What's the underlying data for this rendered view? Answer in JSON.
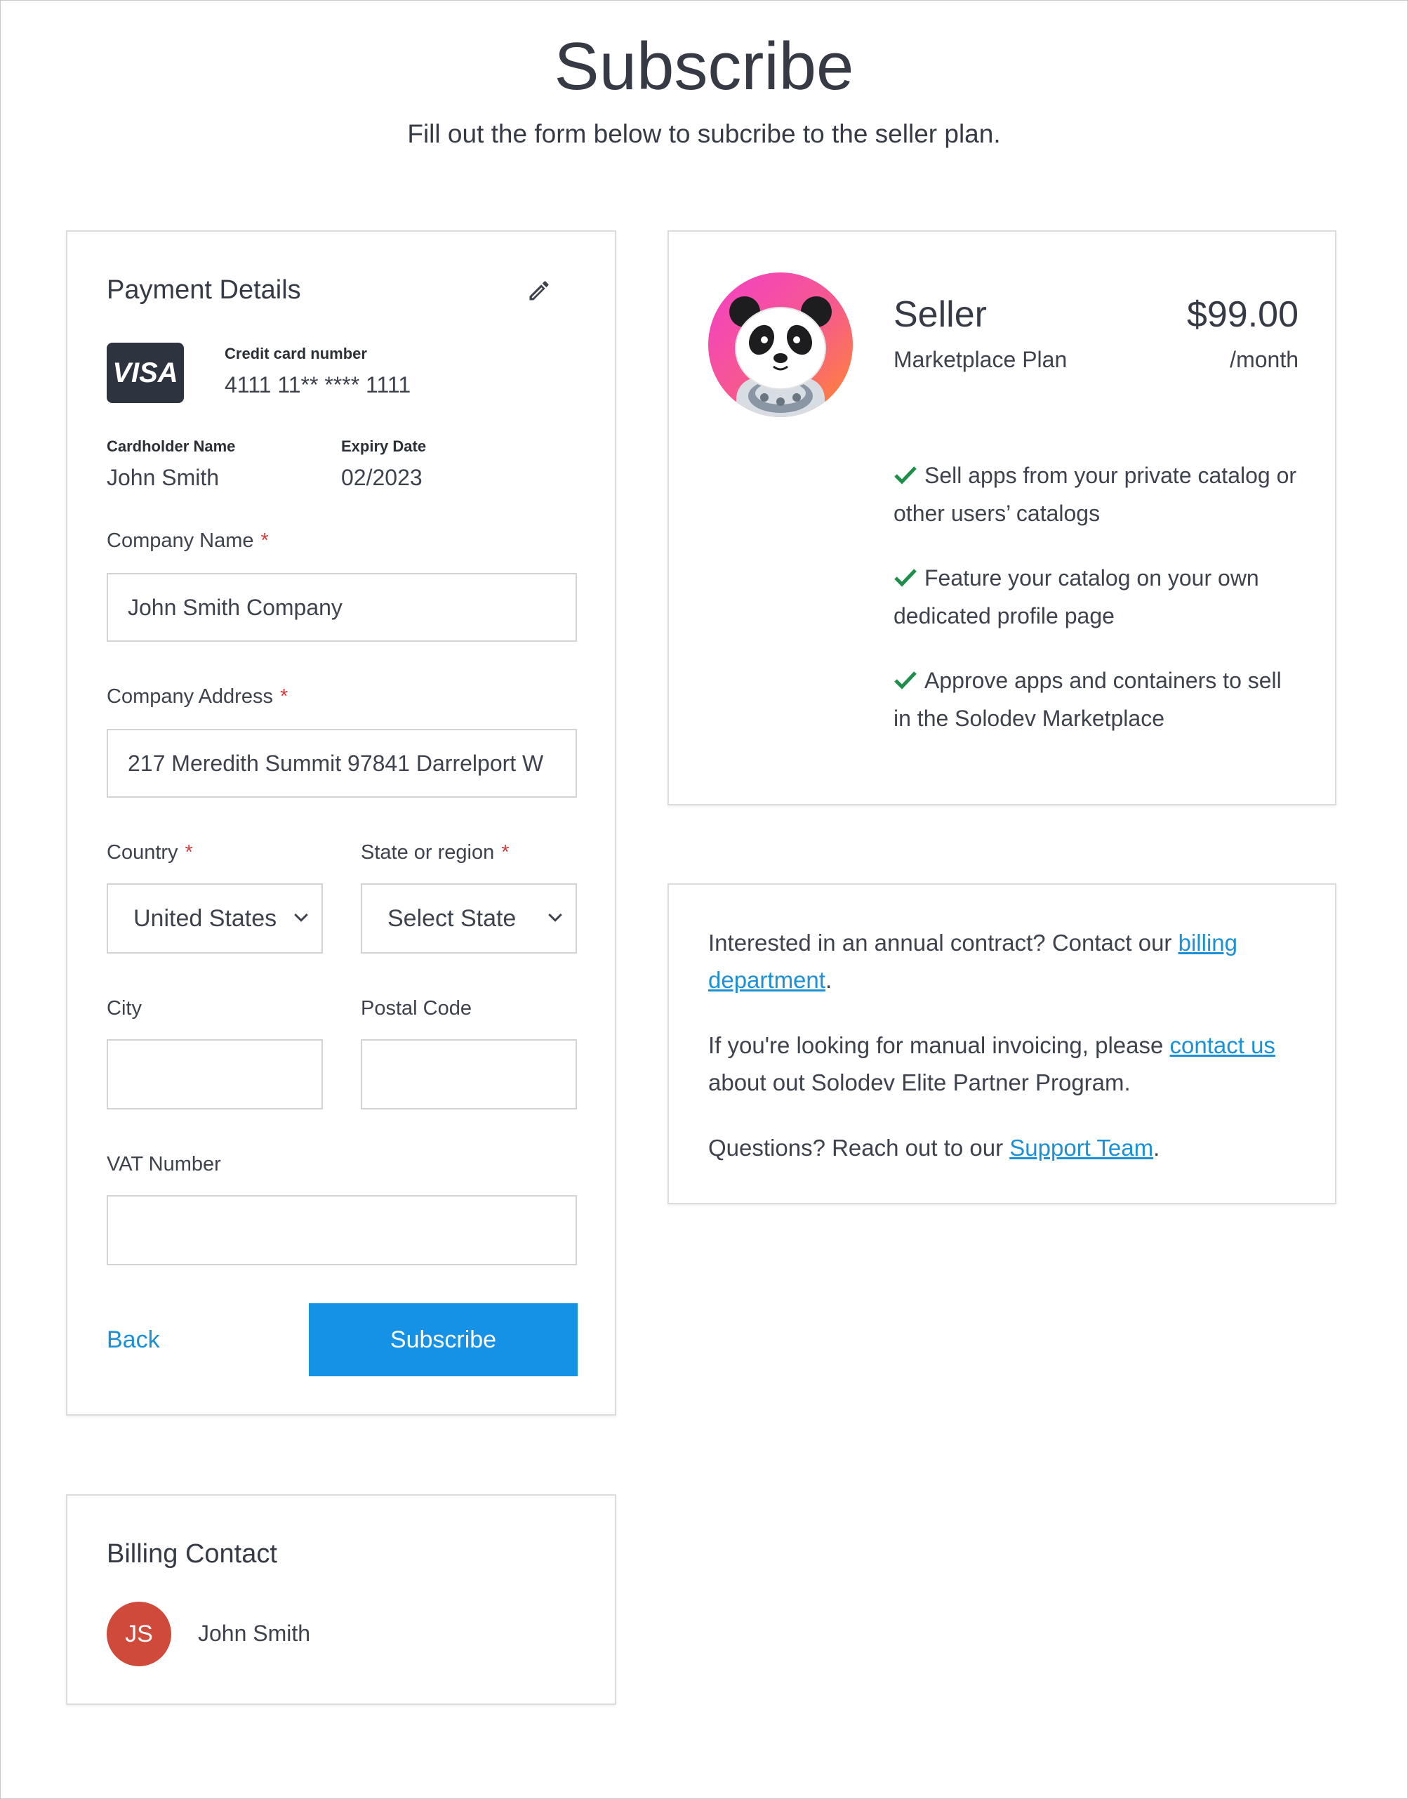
{
  "page": {
    "title": "Subscribe",
    "subtitle": "Fill out the form below to subcribe to the seller plan."
  },
  "payment": {
    "heading": "Payment Details",
    "edit_icon": "pencil-icon",
    "card_brand": "VISA",
    "card_number_label": "Credit card number",
    "card_number": "4111 11** **** 1111",
    "cardholder_label": "Cardholder Name",
    "cardholder": "John Smith",
    "expiry_label": "Expiry Date",
    "expiry": "02/2023"
  },
  "form": {
    "company_name_label": "Company Name",
    "company_name_value": "John Smith Company",
    "company_address_label": "Company Address",
    "company_address_value": "217 Meredith Summit 97841 Darrelport W",
    "country_label": "Country",
    "country_value": "United States",
    "state_label": "State or region",
    "state_value": "Select State",
    "city_label": "City",
    "city_value": "",
    "postal_label": "Postal Code",
    "postal_value": "",
    "vat_label": "VAT Number",
    "vat_value": "",
    "required_marker": "*",
    "back_label": "Back",
    "subscribe_label": "Subscribe"
  },
  "billing": {
    "heading": "Billing Contact",
    "initials": "JS",
    "name": "John Smith"
  },
  "plan": {
    "name": "Seller",
    "subtitle": "Marketplace Plan",
    "price": "$99.00",
    "period": "/month",
    "features": [
      "Sell apps from your private catalog or other users’ catalogs",
      "Feature your catalog on your own dedicated profile page",
      "Approve apps and containers to sell in the Solodev Marketplace"
    ]
  },
  "info": {
    "p1_text": "Interested in an annual contract? Contact our ",
    "p1_link": "billing department",
    "p1_end": ".",
    "p2_text": "If you're looking for manual invoicing, please ",
    "p2_link": "contact us",
    "p2_end": " about out Solodev Elite Partner Program.",
    "p3_text": "Questions? Reach out to our ",
    "p3_link": "Support Team",
    "p3_end": "."
  },
  "colors": {
    "primary": "#1592e6",
    "link": "#1a90d6",
    "check": "#1e8e4a",
    "avatar": "#d04a3c",
    "required": "#d23b3b"
  }
}
